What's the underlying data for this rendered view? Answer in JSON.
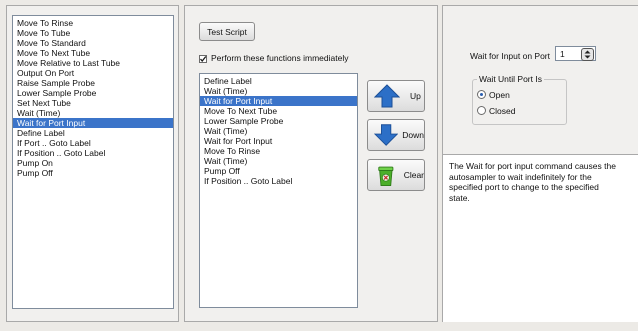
{
  "commands_list": {
    "items": [
      "Move To Rinse",
      "Move To Tube",
      "Move To Standard",
      "Move To Next Tube",
      "Move Relative to Last Tube",
      "Output On Port",
      "Raise Sample Probe",
      "Lower Sample Probe",
      "Set Next Tube",
      "Wait (Time)",
      "Wait for Port Input",
      "Define Label",
      "If Port .. Goto Label",
      "If Position .. Goto Label",
      "Pump On",
      "Pump Off"
    ],
    "selected_index": 10
  },
  "script_panel": {
    "test_script_label": "Test Script",
    "perform_label": "Perform these functions immediately",
    "perform_checked": true,
    "items": [
      "Define Label",
      "Wait (Time)",
      "Wait for Port Input",
      "Move To Next Tube",
      "Lower Sample Probe",
      "Wait (Time)",
      "Wait for Port Input",
      "Move To Rinse",
      "Wait (Time)",
      "Pump Off",
      "If Position .. Goto Label"
    ],
    "selected_index": 2
  },
  "actions": {
    "up_label": "Up",
    "down_label": "Down",
    "clear_label": "Clear"
  },
  "properties": {
    "port_label": "Wait for Input on Port",
    "port_value": "1",
    "group_title": "Wait Until Port Is",
    "open_label": "Open",
    "closed_label": "Closed",
    "selected_state": "Open",
    "description": "The Wait for port input command causes the autosampler to wait indefinitely for the specified port to change to the specified state."
  },
  "colors": {
    "selection": "#3b74c9",
    "arrow_blue": "#2c6fc7",
    "bin_green": "#4caf2a"
  }
}
